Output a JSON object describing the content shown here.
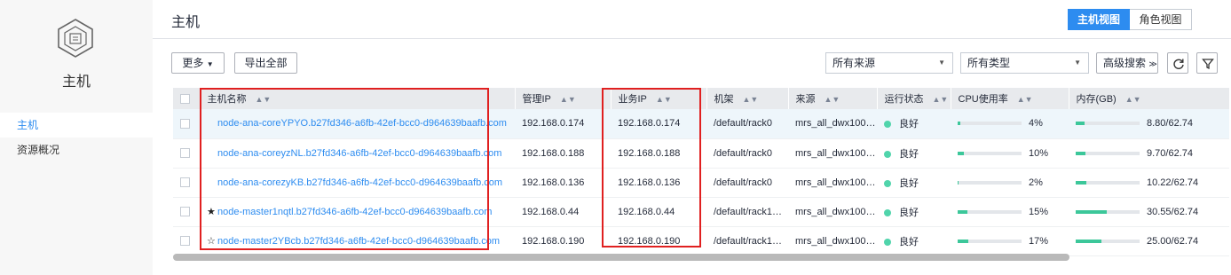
{
  "sidebar": {
    "title": "主机",
    "items": [
      {
        "label": "主机"
      },
      {
        "label": "资源概况"
      }
    ]
  },
  "header": {
    "title": "主机",
    "view_host": "主机视图",
    "view_role": "角色视图"
  },
  "toolbar": {
    "more": "更多",
    "export_all": "导出全部",
    "source_filter": "所有来源",
    "type_filter": "所有类型",
    "advanced_search": "高级搜索"
  },
  "table": {
    "columns": [
      "主机名称",
      "管理IP",
      "业务IP",
      "机架",
      "来源",
      "运行状态",
      "CPU使用率",
      "内存(GB)"
    ],
    "rows": [
      {
        "star": "",
        "name": "node-ana-coreYPYO.b27fd346-a6fb-42ef-bcc0-d964639baafb.com",
        "mgmt_ip": "192.168.0.174",
        "biz_ip": "192.168.0.174",
        "rack": "/default/rack0",
        "source": "mrs_all_dwx100…",
        "status": "良好",
        "cpu": "4%",
        "cpu_pct": 4,
        "mem": "8.80/62.74",
        "mem_pct": 14
      },
      {
        "star": "",
        "name": "node-ana-coreyzNL.b27fd346-a6fb-42ef-bcc0-d964639baafb.com",
        "mgmt_ip": "192.168.0.188",
        "biz_ip": "192.168.0.188",
        "rack": "/default/rack0",
        "source": "mrs_all_dwx100…",
        "status": "良好",
        "cpu": "10%",
        "cpu_pct": 10,
        "mem": "9.70/62.74",
        "mem_pct": 15
      },
      {
        "star": "",
        "name": "node-ana-corezyKB.b27fd346-a6fb-42ef-bcc0-d964639baafb.com",
        "mgmt_ip": "192.168.0.136",
        "biz_ip": "192.168.0.136",
        "rack": "/default/rack0",
        "source": "mrs_all_dwx100…",
        "status": "良好",
        "cpu": "2%",
        "cpu_pct": 2,
        "mem": "10.22/62.74",
        "mem_pct": 16
      },
      {
        "star": "★",
        "name": "node-master1nqtl.b27fd346-a6fb-42ef-bcc0-d964639baafb.com",
        "mgmt_ip": "192.168.0.44",
        "biz_ip": "192.168.0.44",
        "rack": "/default/rack1…",
        "source": "mrs_all_dwx100…",
        "status": "良好",
        "cpu": "15%",
        "cpu_pct": 15,
        "mem": "30.55/62.74",
        "mem_pct": 49
      },
      {
        "star": "☆",
        "name": "node-master2YBcb.b27fd346-a6fb-42ef-bcc0-d964639baafb.com",
        "mgmt_ip": "192.168.0.190",
        "biz_ip": "192.168.0.190",
        "rack": "/default/rack1…",
        "source": "mrs_all_dwx100…",
        "status": "良好",
        "cpu": "17%",
        "cpu_pct": 17,
        "mem": "25.00/62.74",
        "mem_pct": 40
      }
    ]
  },
  "colors": {
    "accent": "#2d8cf0",
    "status_good": "#50d4ab",
    "bar_fill": "#3cc79a",
    "highlight_box": "#e02020"
  }
}
